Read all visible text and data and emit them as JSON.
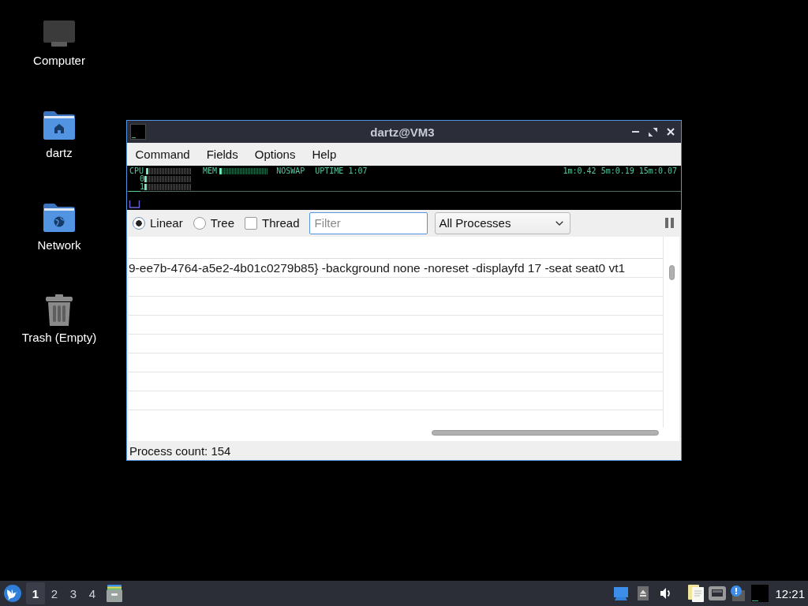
{
  "desktop_icons": [
    {
      "kind": "computer",
      "label": "Computer"
    },
    {
      "kind": "home",
      "label": "dartz"
    },
    {
      "kind": "network",
      "label": "Network"
    },
    {
      "kind": "trash",
      "label": "Trash (Empty)"
    }
  ],
  "window": {
    "title": "dartz@VM3",
    "menu": [
      "Command",
      "Fields",
      "Options",
      "Help"
    ],
    "meters": {
      "bars": [
        {
          "label": "CPU",
          "level": 0.05
        },
        {
          "label": "MEM",
          "level": 0.04
        }
      ],
      "swap": "NOSWAP",
      "uptime": "UPTIME 1:07",
      "load": "1m:0.42 5m:0.19 15m:0.07",
      "cores": [
        {
          "label": "0",
          "level": 0.05
        },
        {
          "label": "1",
          "level": 0.05
        }
      ]
    },
    "view_modes": [
      {
        "label": "Linear",
        "selected": true
      },
      {
        "label": "Tree",
        "selected": false
      }
    ],
    "thread": {
      "label": "Thread",
      "checked": false
    },
    "filter": {
      "placeholder": "Filter",
      "focused": true
    },
    "process_filter": {
      "value": "All Processes"
    },
    "table": {
      "rows": [
        {
          "command": "9-ee7b-4764-a5e2-4b01c0279b85} -background none -noreset -displayfd 17 -seat seat0 vt1"
        }
      ]
    },
    "status_bar": "Process count: 154"
  },
  "taskbar": {
    "workspaces": [
      {
        "label": "1",
        "selected": true
      },
      {
        "label": "2",
        "selected": false
      },
      {
        "label": "3",
        "selected": false
      },
      {
        "label": "4",
        "selected": false
      }
    ],
    "clock": "12:21"
  }
}
